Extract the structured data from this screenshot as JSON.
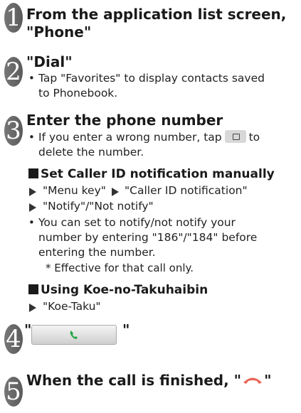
{
  "steps": [
    {
      "num": "1",
      "title_line1": "From the application list screen,",
      "title_line2": "\"Phone\""
    },
    {
      "num": "2",
      "title": "\"Dial\"",
      "bullet": "Tap \"Favorites\" to display contacts saved",
      "bullet_cont": "to Phonebook."
    },
    {
      "num": "3",
      "title": "Enter the phone number",
      "bullet_a": "If you enter a wrong number, tap",
      "bullet_b": "to",
      "bullet_cont": "delete the number."
    },
    {
      "num": "4",
      "quote_open": "\"",
      "quote_close": "\""
    },
    {
      "num": "5",
      "title": "When the call is finished, \"",
      "title_end": "\""
    }
  ],
  "caller_id": {
    "heading": "Set Caller ID notification manually",
    "line1_a": "\"Menu key\"",
    "line1_b": "\"Caller ID notification\"",
    "line2": "\"Notify\"/\"Not notify\"",
    "bullet_l1": "You can set to notify/not notify your",
    "bullet_l2": "number by entering \"186\"/\"184\" before",
    "bullet_l3": "entering the number.",
    "note": "* Effective for that call only."
  },
  "koe": {
    "heading": "Using Koe-no-Takuhaibin",
    "line1": "\"Koe-Taku\""
  },
  "colors": {
    "call_icon": "#2aa84a",
    "end_icon": "#e8665a",
    "badge": "#666666"
  },
  "icons": {
    "call": "phone-call-icon",
    "end": "end-call-icon",
    "delete": "delete-key-icon"
  }
}
